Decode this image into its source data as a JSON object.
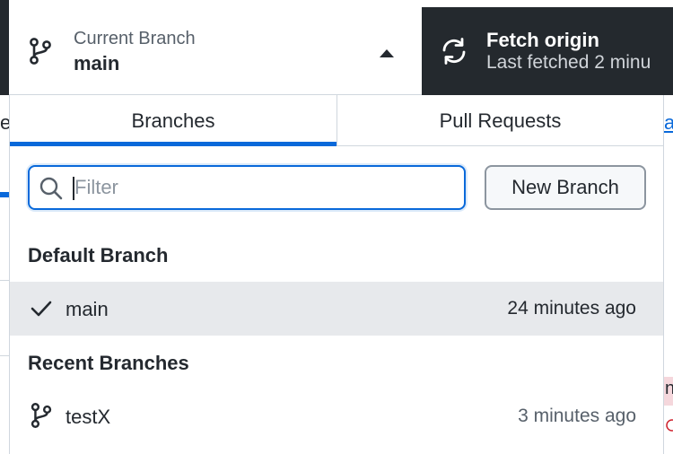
{
  "toolbar": {
    "current_branch_label": "Current Branch",
    "current_branch_name": "main",
    "fetch_title": "Fetch origin",
    "fetch_subtitle": "Last fetched 2 minu"
  },
  "tabs": [
    {
      "label": "Branches",
      "selected": true
    },
    {
      "label": "Pull Requests",
      "selected": false
    }
  ],
  "filter": {
    "placeholder": "Filter",
    "value": ""
  },
  "new_branch_label": "New Branch",
  "sections": {
    "default": {
      "title": "Default Branch",
      "items": [
        {
          "name": "main",
          "time": "24 minutes ago",
          "icon": "check-icon",
          "selected": true
        }
      ]
    },
    "recent": {
      "title": "Recent Branches",
      "items": [
        {
          "name": "testX",
          "time": "3 minutes ago",
          "icon": "branch-icon",
          "selected": false
        }
      ]
    }
  },
  "background": {
    "left_letter": "e",
    "right_letter": "a",
    "right_pink_letter": "n"
  },
  "colors": {
    "accent": "#0969da",
    "toolbar_dark": "#24292e",
    "selected_row": "#e7e9ec"
  }
}
